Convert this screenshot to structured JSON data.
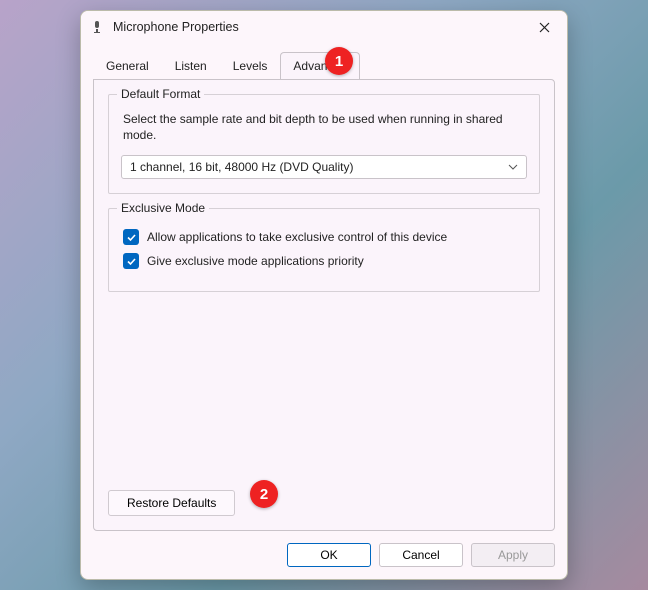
{
  "title": "Microphone Properties",
  "tabs": [
    "General",
    "Listen",
    "Levels",
    "Advanced"
  ],
  "activeTab": 3,
  "defaultFormat": {
    "legend": "Default Format",
    "desc": "Select the sample rate and bit depth to be used when running in shared mode.",
    "selected": "1 channel, 16 bit, 48000 Hz (DVD Quality)"
  },
  "exclusiveMode": {
    "legend": "Exclusive Mode",
    "opt1": "Allow applications to take exclusive control of this device",
    "opt2": "Give exclusive mode applications priority"
  },
  "restore": "Restore Defaults",
  "footer": {
    "ok": "OK",
    "cancel": "Cancel",
    "apply": "Apply"
  },
  "annotations": {
    "a1": "1",
    "a2": "2"
  }
}
